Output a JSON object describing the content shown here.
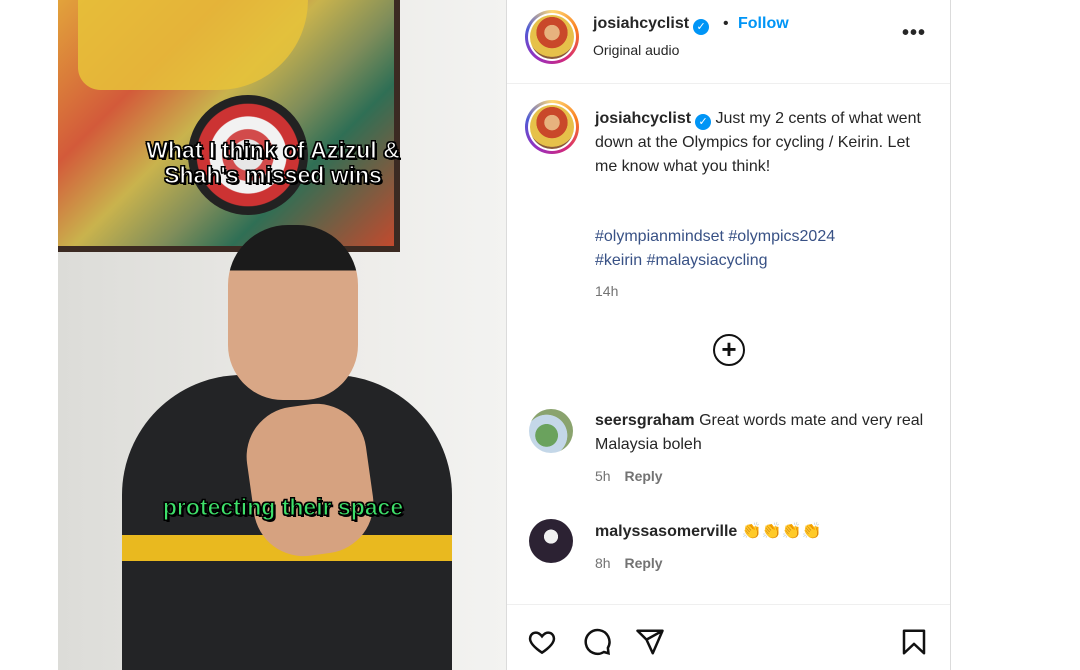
{
  "video": {
    "caption_top": "What I think of Azizul & Shah's missed wins",
    "caption_bottom": "protecting their space"
  },
  "header": {
    "username": "josiahcyclist",
    "separator": "•",
    "follow_label": "Follow",
    "audio_label": "Original audio",
    "more_label": "•••"
  },
  "post": {
    "username": "josiahcyclist",
    "caption": "Just my 2 cents of what went down at the Olympics for cycling / Keirin. Let me know what you think!",
    "hashtags_line1": "#olympianmindset #olympics2024",
    "hashtags_line2": "#keirin #malaysiacycling",
    "time": "14h",
    "load_more": "+"
  },
  "comments": [
    {
      "username": "seersgraham",
      "text": "Great words mate and very real Malaysia boleh",
      "time": "5h",
      "reply_label": "Reply"
    },
    {
      "username": "malyssasomerville",
      "text": "👏👏👏👏",
      "time": "8h",
      "reply_label": "Reply"
    }
  ],
  "actions": {
    "icons": [
      "heart-icon",
      "comment-icon",
      "share-icon",
      "bookmark-icon"
    ]
  },
  "colors": {
    "accent": "#0095f6",
    "hashtag": "#385185",
    "subtitle_green": "#3ee06a"
  }
}
